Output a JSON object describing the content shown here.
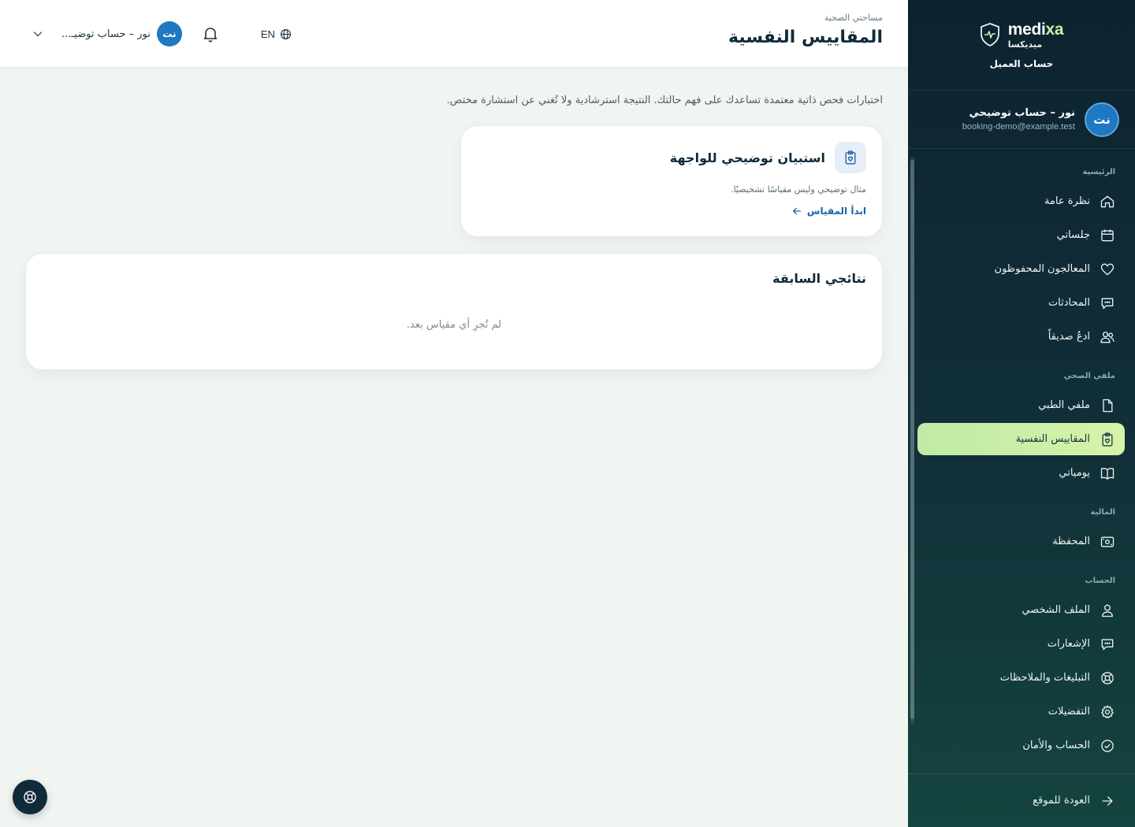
{
  "brand": {
    "latin_prefix": "medi",
    "latin_suffix": "xa",
    "arabic": "ميديكسا",
    "account_kind": "حساب العميل"
  },
  "user": {
    "initials": "نت",
    "name": "نور – حساب توضيحي",
    "email": "booking-demo@example.test",
    "short_name": "نور – حساب توضيـ..."
  },
  "nav": {
    "sections": [
      {
        "title": "الرئيسية",
        "items": [
          {
            "label": "نظرة عامة",
            "icon": "home-icon"
          },
          {
            "label": "جلساتي",
            "icon": "calendar-icon"
          },
          {
            "label": "المعالجون المحفوظون",
            "icon": "heart-icon"
          },
          {
            "label": "المحادثات",
            "icon": "chat-icon"
          },
          {
            "label": "ادعُ صديقاً",
            "icon": "users-icon"
          }
        ]
      },
      {
        "title": "ملفي الصحي",
        "items": [
          {
            "label": "ملفي الطبي",
            "icon": "file-icon"
          },
          {
            "label": "المقاييس النفسية",
            "icon": "clipboard-icon",
            "active": true
          },
          {
            "label": "يومياتي",
            "icon": "book-icon"
          }
        ]
      },
      {
        "title": "المالية",
        "items": [
          {
            "label": "المحفظة",
            "icon": "wallet-icon"
          }
        ]
      },
      {
        "title": "الحساب",
        "items": [
          {
            "label": "الملف الشخصي",
            "icon": "user-icon"
          },
          {
            "label": "الإشعارات",
            "icon": "message-icon"
          },
          {
            "label": "التبليغات والملاحظات",
            "icon": "lifebuoy-icon"
          },
          {
            "label": "التفضيلات",
            "icon": "gear-icon"
          },
          {
            "label": "الحساب والأمان",
            "icon": "check-circle-icon"
          }
        ]
      }
    ],
    "back_label": "العودة للموقع"
  },
  "header": {
    "breadcrumb": "مساحتي الصحية",
    "title": "المقاييس النفسية",
    "lang_code": "EN"
  },
  "main": {
    "intro": "اختبارات فحص ذاتية معتمدة تساعدك على فهم حالتك. النتيجة استرشادية ولا تُغني عن استشارة مختص.",
    "scale_card": {
      "title": "استبيان توضيحي للواجهة",
      "description": "مثال توضيحي وليس مقياسًا تشخيصيًا.",
      "start_label": "ابدأ المقياس"
    },
    "results": {
      "title": "نتائجي السابقة",
      "empty_text": "لم تُجرِ أي مقياس بعد."
    }
  },
  "colors": {
    "sidebar": "#0d2330",
    "active_nav": "#c9eea8",
    "accent_blue": "#1e78c2",
    "link": "#1d62a3"
  }
}
